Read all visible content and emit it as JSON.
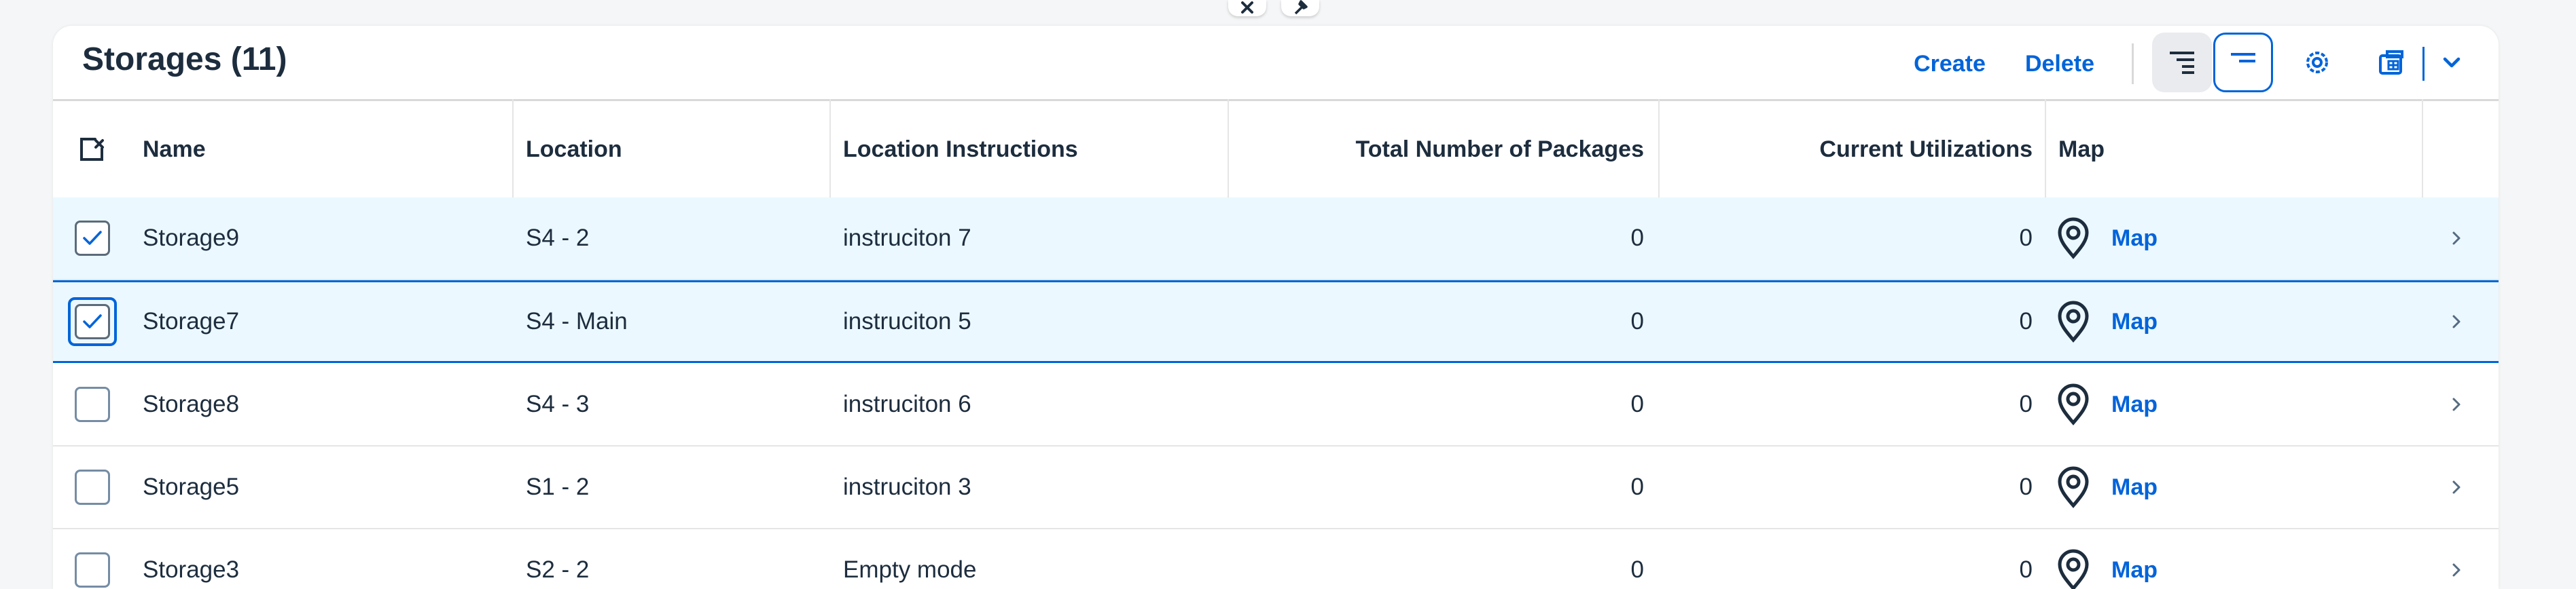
{
  "toolbar": {
    "title": "Storages (11)",
    "create_label": "Create",
    "delete_label": "Delete"
  },
  "columns": {
    "name": "Name",
    "location": "Location",
    "instructions": "Location Instructions",
    "packages": "Total Number of Packages",
    "utilizations": "Current Utilizations",
    "map": "Map"
  },
  "rows": [
    {
      "name": "Storage9",
      "location": "S4 - 2",
      "instructions": "instruciton 7",
      "packages": "0",
      "utilizations": "0",
      "map": "Map",
      "selected": true
    },
    {
      "name": "Storage7",
      "location": "S4 - Main",
      "instructions": "instruciton 5",
      "packages": "0",
      "utilizations": "0",
      "map": "Map",
      "selected": true
    },
    {
      "name": "Storage8",
      "location": "S4 - 3",
      "instructions": "instruciton 6",
      "packages": "0",
      "utilizations": "0",
      "map": "Map",
      "selected": false
    },
    {
      "name": "Storage5",
      "location": "S1 - 2",
      "instructions": "instruciton 3",
      "packages": "0",
      "utilizations": "0",
      "map": "Map",
      "selected": false
    },
    {
      "name": "Storage3",
      "location": "S2 - 2",
      "instructions": "Empty mode",
      "packages": "0",
      "utilizations": "0",
      "map": "Map",
      "selected": false
    }
  ],
  "colors": {
    "accent": "#0064d9",
    "selected_row": "#ebf8ff",
    "text": "#1d2d3e"
  },
  "icons": [
    "close-icon",
    "pin-icon",
    "sort-icon",
    "group-icon",
    "settings-icon",
    "export-icon",
    "chevron-down-icon",
    "select-all-icon",
    "location-pin-icon",
    "chevron-right-icon"
  ]
}
